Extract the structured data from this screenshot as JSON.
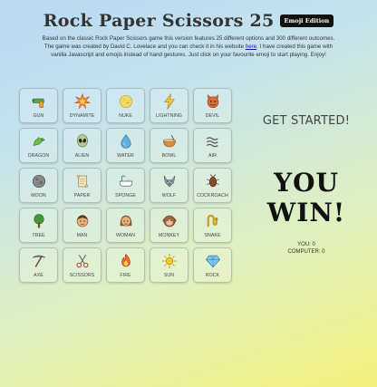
{
  "header": {
    "title": "Rock Paper Scissors 25",
    "badge": "Emoji Edition",
    "desc_before_link": "Based on the classic Rock Paper Scissors game this version features 25 different options and 300 different outcomes. The game was created by David C. Lovelace and you can check it in his website ",
    "desc_link": "here",
    "desc_after_link": ". I have created this game with vanilla Javascript and emojis instead of hand gestures. Just click on your favourite emoji to start playing. Enjoy!"
  },
  "options": [
    {
      "label": "GUN",
      "icon": "gun-icon"
    },
    {
      "label": "DYNAMITE",
      "icon": "explosion-icon"
    },
    {
      "label": "NUKE",
      "icon": "nuke-icon"
    },
    {
      "label": "LIGHTNING",
      "icon": "lightning-icon"
    },
    {
      "label": "DEVIL",
      "icon": "devil-icon"
    },
    {
      "label": "DRAGON",
      "icon": "dragon-icon"
    },
    {
      "label": "ALIEN",
      "icon": "alien-icon"
    },
    {
      "label": "WATER",
      "icon": "water-drop-icon"
    },
    {
      "label": "BOWL",
      "icon": "bowl-icon"
    },
    {
      "label": "AIR",
      "icon": "air-icon"
    },
    {
      "label": "MOON",
      "icon": "moon-icon"
    },
    {
      "label": "PAPER",
      "icon": "scroll-icon"
    },
    {
      "label": "SPONGE",
      "icon": "bathtub-icon"
    },
    {
      "label": "WOLF",
      "icon": "wolf-icon"
    },
    {
      "label": "COCKROACH",
      "icon": "cockroach-icon"
    },
    {
      "label": "TREE",
      "icon": "tree-icon"
    },
    {
      "label": "MAN",
      "icon": "man-icon"
    },
    {
      "label": "WOMAN",
      "icon": "woman-icon"
    },
    {
      "label": "MONKEY",
      "icon": "monkey-icon"
    },
    {
      "label": "SNAKE",
      "icon": "snake-icon"
    },
    {
      "label": "AXE",
      "icon": "pick-icon"
    },
    {
      "label": "SCISSORS",
      "icon": "scissors-icon"
    },
    {
      "label": "FIRE",
      "icon": "fire-icon"
    },
    {
      "label": "SUN",
      "icon": "sun-icon"
    },
    {
      "label": "ROCK",
      "icon": "diamond-icon"
    }
  ],
  "status": {
    "get_started": "GET STARTED!",
    "result": "YOU WIN!",
    "you_label": "YOU: 0",
    "computer_label": "COMPUTER: 0"
  }
}
